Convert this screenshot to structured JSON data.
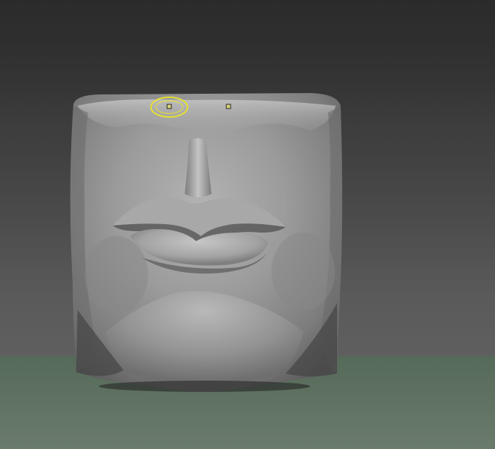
{
  "canvas": {
    "background_top": "#2b2b2b",
    "background_bottom": "#5f5f5f",
    "floor_color": "#5f7262"
  },
  "model": {
    "name": "sculpted-face-block",
    "base_color": "#9a9a9a"
  },
  "brush": {
    "cursor_color": "#e6e030"
  },
  "markers": [
    {
      "name": "symmetry-point-left",
      "color": "#d8d27a"
    },
    {
      "name": "symmetry-point-right",
      "color": "#d8d27a"
    }
  ]
}
